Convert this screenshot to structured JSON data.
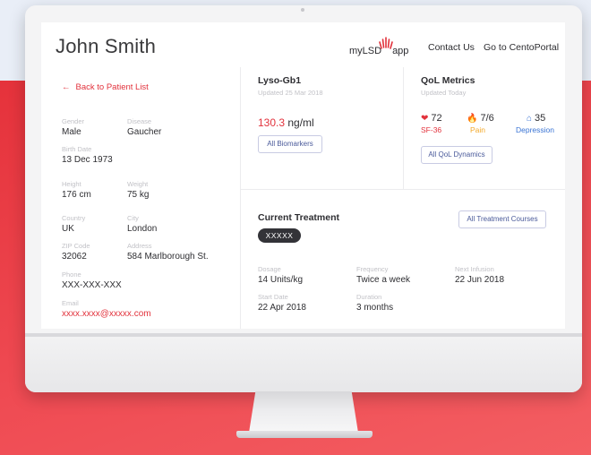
{
  "colors": {
    "accent_red": "#e2323c",
    "pain_orange": "#f3a92b",
    "depression_blue": "#3a74d4",
    "button_border": "#c8cbe3"
  },
  "header": {
    "patient_name": "John Smith",
    "logo_text": "myLSD",
    "logo_suffix": "app",
    "nav": {
      "contact": "Contact Us",
      "cento": "Go to CentoPortal"
    }
  },
  "patient": {
    "back_label": "Back to Patient List",
    "back_icon": "arrow-left-icon",
    "gender": {
      "label": "Gender",
      "value": "Male"
    },
    "disease": {
      "label": "Disease",
      "value": "Gaucher"
    },
    "birth_date": {
      "label": "Birth Date",
      "value": "13 Dec 1973"
    },
    "height": {
      "label": "Height",
      "value": "176 cm"
    },
    "weight": {
      "label": "Weight",
      "value": "75 kg"
    },
    "country": {
      "label": "Country",
      "value": "UK"
    },
    "city": {
      "label": "City",
      "value": "London"
    },
    "zip": {
      "label": "ZIP Code",
      "value": "32062"
    },
    "address": {
      "label": "Address",
      "value": "584 Marlborough St."
    },
    "phone": {
      "label": "Phone",
      "value": "XXX-XXX-XXX"
    },
    "email": {
      "label": "Email",
      "value": "xxxx.xxxx@xxxxx.com"
    }
  },
  "biomarker": {
    "title": "Lyso-Gb1",
    "updated": "Updated 25 Mar 2018",
    "value": "130.3",
    "unit": "ng/ml",
    "button": "All Biomarkers"
  },
  "qol": {
    "title": "QoL Metrics",
    "updated": "Updated Today",
    "metrics": [
      {
        "icon": "heart-icon",
        "value": "72",
        "label": "SF-36"
      },
      {
        "icon": "flame-icon",
        "value": "7/6",
        "label": "Pain"
      },
      {
        "icon": "home-icon",
        "value": "35",
        "label": "Depression"
      }
    ],
    "button": "All QoL Dynamics"
  },
  "treatment": {
    "title": "Current Treatment",
    "drug": "XXXXX",
    "button": "All Treatment Courses",
    "dosage": {
      "label": "Dosage",
      "value": "14 Units/kg"
    },
    "frequency": {
      "label": "Frequency",
      "value": "Twice a week"
    },
    "next_infusion": {
      "label": "Next Infusion",
      "value": "22 Jun 2018"
    },
    "start_date": {
      "label": "Start Date",
      "value": "22 Apr 2018"
    },
    "duration": {
      "label": "Duration",
      "value": "3 months"
    }
  }
}
